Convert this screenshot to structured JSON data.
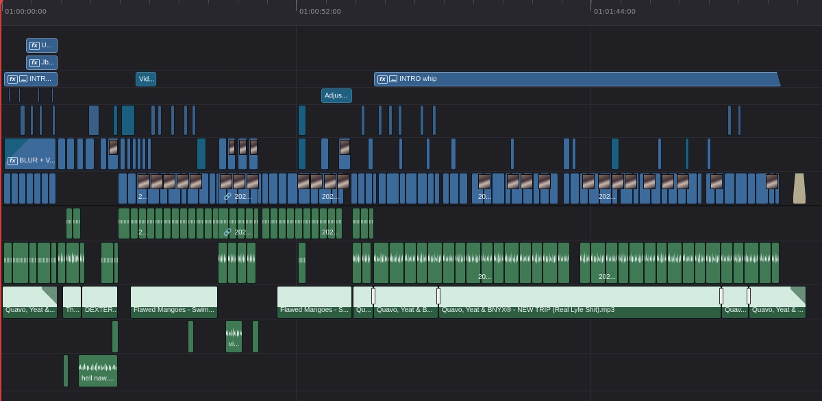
{
  "ruler": {
    "labels": [
      "01:00:00:00",
      "01:00:52:00",
      "01:01:44:00"
    ]
  },
  "clips": {
    "fx_u": "U...",
    "fx_jb": "Jb...",
    "intro_short": "INTR...",
    "vid": "Vid...",
    "intro_whip": "INTRO whip",
    "adjust": "Adjus...",
    "blur": "BLUR + V...",
    "v1_a": "2...",
    "v1_b": "202...",
    "v1_c": "202...",
    "v1_d": "20...",
    "v1_e": "202...",
    "a1_a": "2...",
    "a1_b": "202...",
    "a1_c": "202...",
    "a2_a": "20...",
    "a2_b": "202...",
    "m1": "Quavo, Yeat &...",
    "m2": "Th...",
    "m3": "DEXTER...",
    "m4": "Flawed Mangoes - Swim...",
    "m5": "Flawed Mangoes - S...",
    "m6": "Qu...",
    "m7": "Quavo, Yeat & B...",
    "m8": "Quavo, Yeat & BNYX® - NEW TRIP (Real Lyfe Shit).mp3",
    "m9": "Quav...",
    "m10": "Quavo, Yeat & ...",
    "vi": "vi...",
    "hell": "hell naw...."
  },
  "colors": {
    "playhead": "#d93b3b",
    "video_clip": "#3c6a9b",
    "audio_clip": "#3f7a55",
    "music_waveform": "#cfe9dc"
  }
}
